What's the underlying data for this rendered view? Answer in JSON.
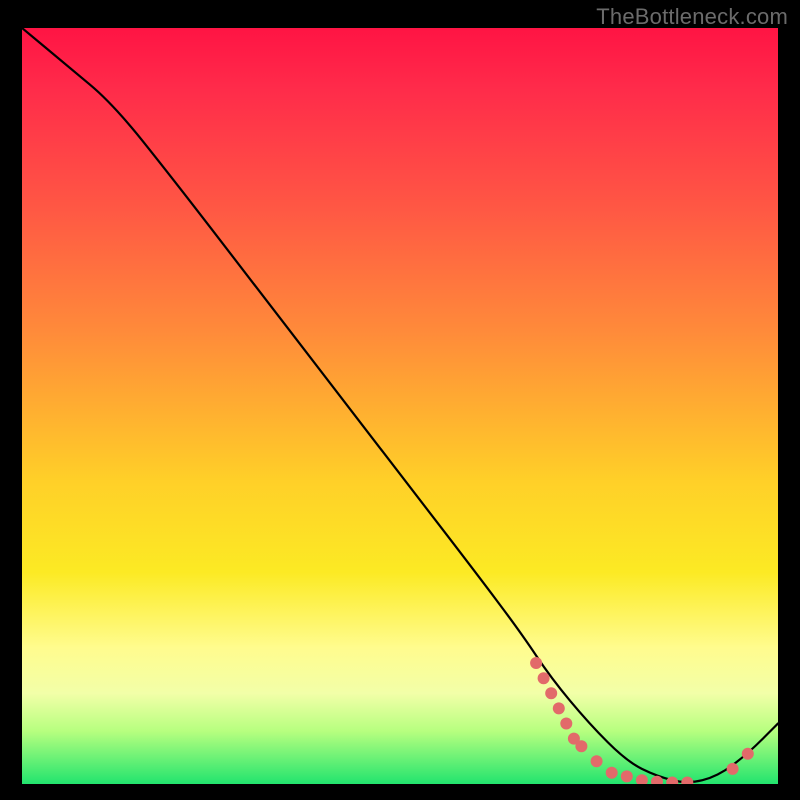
{
  "watermark": "TheBottleneck.com",
  "chart_data": {
    "type": "line",
    "title": "",
    "xlabel": "",
    "ylabel": "",
    "xlim": [
      0,
      100
    ],
    "ylim": [
      0,
      100
    ],
    "series": [
      {
        "name": "curve",
        "x": [
          0,
          6,
          12,
          20,
          30,
          40,
          50,
          60,
          66,
          70,
          75,
          80,
          84,
          88,
          92,
          96,
          100
        ],
        "y": [
          100,
          95,
          90,
          80,
          67,
          54,
          41,
          28,
          20,
          14,
          8,
          3,
          1,
          0,
          1,
          4,
          8
        ]
      }
    ],
    "markers": {
      "name": "highlight-points",
      "color": "#e26a6a",
      "points": [
        {
          "x": 68,
          "y": 16
        },
        {
          "x": 69,
          "y": 14
        },
        {
          "x": 70,
          "y": 12
        },
        {
          "x": 71,
          "y": 10
        },
        {
          "x": 72,
          "y": 8
        },
        {
          "x": 73,
          "y": 6
        },
        {
          "x": 74,
          "y": 5
        },
        {
          "x": 76,
          "y": 3
        },
        {
          "x": 78,
          "y": 1.5
        },
        {
          "x": 80,
          "y": 1
        },
        {
          "x": 82,
          "y": 0.5
        },
        {
          "x": 84,
          "y": 0.3
        },
        {
          "x": 86,
          "y": 0.2
        },
        {
          "x": 88,
          "y": 0.2
        },
        {
          "x": 94,
          "y": 2
        },
        {
          "x": 96,
          "y": 4
        }
      ]
    }
  }
}
